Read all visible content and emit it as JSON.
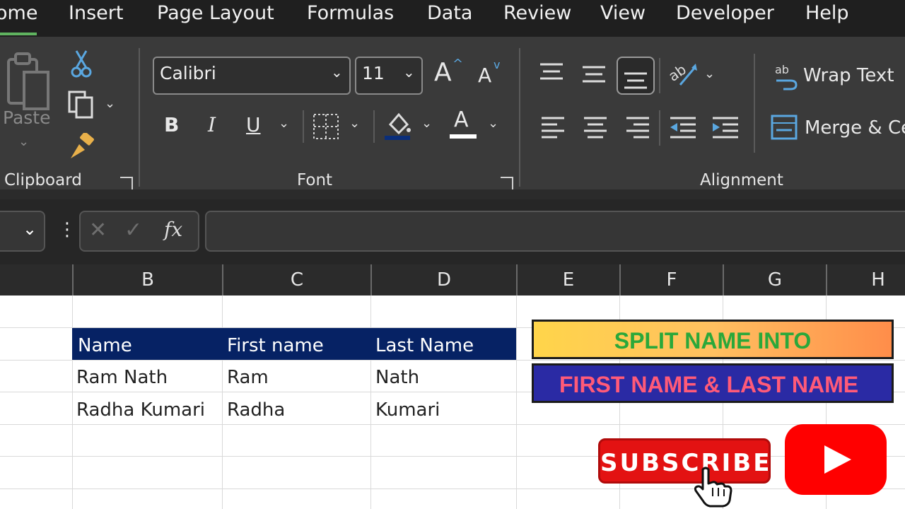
{
  "menu": {
    "tabs": [
      "ome",
      "Insert",
      "Page Layout",
      "Formulas",
      "Data",
      "Review",
      "View",
      "Developer",
      "Help"
    ]
  },
  "ribbon": {
    "clipboard": {
      "paste_label": "Paste",
      "group_label": "Clipboard"
    },
    "font": {
      "font_name": "Calibri",
      "font_size": "11",
      "group_label": "Font",
      "bold": "B",
      "italic": "I",
      "underline": "U",
      "grow": "A",
      "shrink": "A",
      "font_color": "A"
    },
    "alignment": {
      "wrap_text": "Wrap Text",
      "merge": "Merge & Ce",
      "group_label": "Alignment"
    }
  },
  "formula_bar": {
    "fx": "fx",
    "content": ""
  },
  "columns": [
    "B",
    "C",
    "D",
    "E",
    "F",
    "G",
    "H"
  ],
  "table": {
    "headers": [
      "Name",
      "First name",
      "Last Name"
    ],
    "rows": [
      [
        "Ram Nath",
        "Ram",
        "Nath"
      ],
      [
        "Radha Kumari",
        "Radha",
        "Kumari"
      ]
    ]
  },
  "banners": {
    "line1": "SPLIT NAME INTO",
    "line2": "FIRST NAME & LAST NAME"
  },
  "subscribe": {
    "label": "SUBSCRIBE"
  },
  "colors": {
    "header_band": "#062264",
    "banner1_text": "#2aa83a",
    "banner2_bg": "#2a2aa4",
    "banner2_text": "#ff5a78",
    "subscribe_bg": "#e31212",
    "youtube_red": "#ff0000"
  }
}
